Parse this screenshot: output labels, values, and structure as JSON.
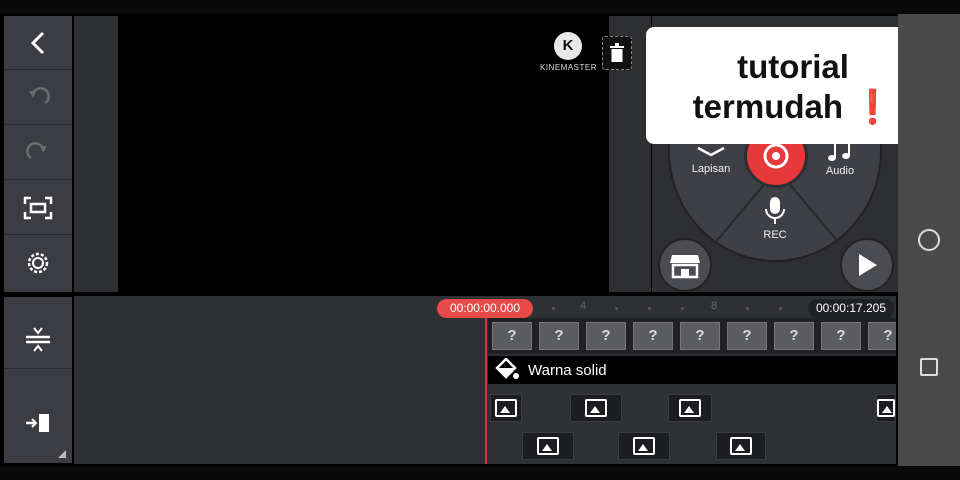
{
  "toolbar": {
    "back": "back-icon",
    "undo": "undo-icon",
    "redo": "redo-icon",
    "crop": "crop-icon",
    "settings": "gear-icon",
    "align": "track-align-icon",
    "jump": "jump-to-end-icon"
  },
  "preview": {
    "logo_letter": "K",
    "logo_text": "KINEMASTER"
  },
  "wheel": {
    "layer_label": "Lapisan",
    "audio_label": "Audio",
    "rec_label": "REC",
    "record_color": "#e63a3a"
  },
  "overlay": {
    "line1": "tutorial",
    "line2": "termudah",
    "emoji": "❗"
  },
  "timeline": {
    "current_time": "00:00:00.000",
    "total_time": "00:00:17.205",
    "tick_labels": [
      "4",
      "8"
    ],
    "missing_thumb": "?",
    "solid_track_label": "Warna solid",
    "accent_color": "#e84a4a"
  }
}
